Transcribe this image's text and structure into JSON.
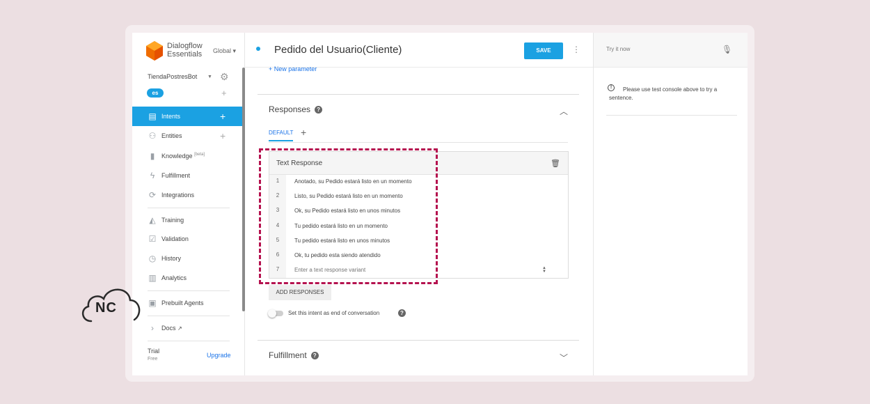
{
  "brand": {
    "name_line1": "Dialogflow",
    "name_line2": "Essentials",
    "region": "Global ▾"
  },
  "agent": {
    "name": "TiendaPostresBot",
    "language": "es"
  },
  "sidebar": {
    "items": [
      {
        "label": "Intents"
      },
      {
        "label": "Entities"
      },
      {
        "label": "Knowledge",
        "badge": "[beta]"
      },
      {
        "label": "Fulfillment"
      },
      {
        "label": "Integrations"
      },
      {
        "label": "Training"
      },
      {
        "label": "Validation"
      },
      {
        "label": "History"
      },
      {
        "label": "Analytics"
      },
      {
        "label": "Prebuilt Agents"
      },
      {
        "label": "Docs"
      }
    ],
    "plan": "Trial",
    "plan_sub": "Free",
    "upgrade": "Upgrade"
  },
  "intent": {
    "title": "Pedido del Usuario(Cliente)",
    "save_label": "SAVE",
    "new_parameter": "New parameter"
  },
  "responses": {
    "title": "Responses",
    "tab_default": "DEFAULT",
    "card_title": "Text Response",
    "items": [
      {
        "num": "1",
        "text": "Anotado, su Pedido estará listo en un momento"
      },
      {
        "num": "2",
        "text": "Listo, su Pedido estará listo en un momento"
      },
      {
        "num": "3",
        "text": "Ok, su Pedido estará listo en unos minutos"
      },
      {
        "num": "4",
        "text": "Tu pedido estará listo en un momento"
      },
      {
        "num": "5",
        "text": "Tu pedido estará listo en unos minutos"
      },
      {
        "num": "6",
        "text": "Ok, tu pedido esta siendo atendido"
      }
    ],
    "new_num": "7",
    "new_placeholder": "Enter a text response variant",
    "add_button": "ADD RESPONSES",
    "end_conversation_label": "Set this intent as end of conversation"
  },
  "fulfillment": {
    "title": "Fulfillment"
  },
  "console": {
    "placeholder": "Try it now",
    "info": "Please use test console above to try a sentence."
  },
  "watermark": {
    "text": "NC"
  },
  "colors": {
    "accent": "#1ba1e2",
    "highlight": "#b5124f",
    "background": "#ecdfe2"
  }
}
